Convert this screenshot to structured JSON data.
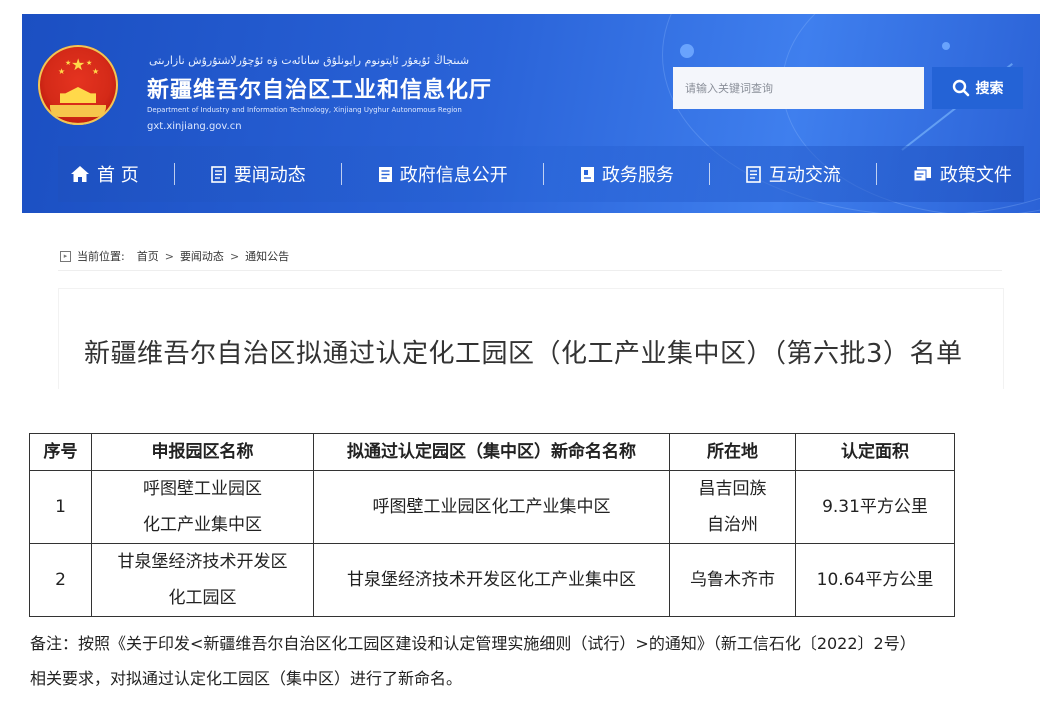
{
  "header": {
    "uyghur_name": "شىنجاڭ ئۇيغۇر ئاپتونوم رايونلۇق سانائەت ۋە ئۇچۇرلاشتۇرۇش نازارىتى",
    "site_name": "新疆维吾尔自治区工业和信息化厅",
    "site_name_en": "Department of Industry and Information Technology, Xinjiang Uyghur Autonomous Region",
    "site_url": "gxt.xinjiang.gov.cn",
    "search_placeholder": "请输入关键词查询",
    "search_button": "搜索",
    "colors": {
      "banner": "#2a63d8",
      "search_button": "#2463d6"
    }
  },
  "nav": {
    "items": [
      {
        "label": "首 页",
        "icon": "home-icon"
      },
      {
        "label": "要闻动态",
        "icon": "news-icon"
      },
      {
        "label": "政府信息公开",
        "icon": "document-icon"
      },
      {
        "label": "政务服务",
        "icon": "service-icon"
      },
      {
        "label": "互动交流",
        "icon": "chat-icon"
      },
      {
        "label": "政策文件",
        "icon": "policy-icon"
      }
    ]
  },
  "breadcrumb": {
    "label": "当前位置:",
    "items": [
      "首页",
      "要闻动态",
      "通知公告"
    ],
    "separator": ">"
  },
  "article": {
    "title": "新疆维吾尔自治区拟通过认定化工园区（化工产业集中区）（第六批3）名单"
  },
  "table": {
    "headers": [
      "序号",
      "申报园区名称",
      "拟通过认定园区（集中区）新命名名称",
      "所在地",
      "认定面积"
    ],
    "rows": [
      {
        "no": "1",
        "name_line1": "呼图壁工业园区",
        "name_line2": "化工产业集中区",
        "new_name": "呼图壁工业园区化工产业集中区",
        "location_line1": "昌吉回族",
        "location_line2": "自治州",
        "area": "9.31平方公里"
      },
      {
        "no": "2",
        "name_line1": "甘泉堡经济技术开发区",
        "name_line2": "化工园区",
        "new_name": "甘泉堡经济技术开发区化工产业集中区",
        "location_line1": "乌鲁木齐市",
        "location_line2": "",
        "area": "10.64平方公里"
      }
    ]
  },
  "note": {
    "line1": "备注：按照《关于印发<新疆维吾尔自治区化工园区建设和认定管理实施细则（试行）>的通知》（新工信石化〔2022〕2号）",
    "line2": "相关要求，对拟通过认定化工园区（集中区）进行了新命名。"
  }
}
